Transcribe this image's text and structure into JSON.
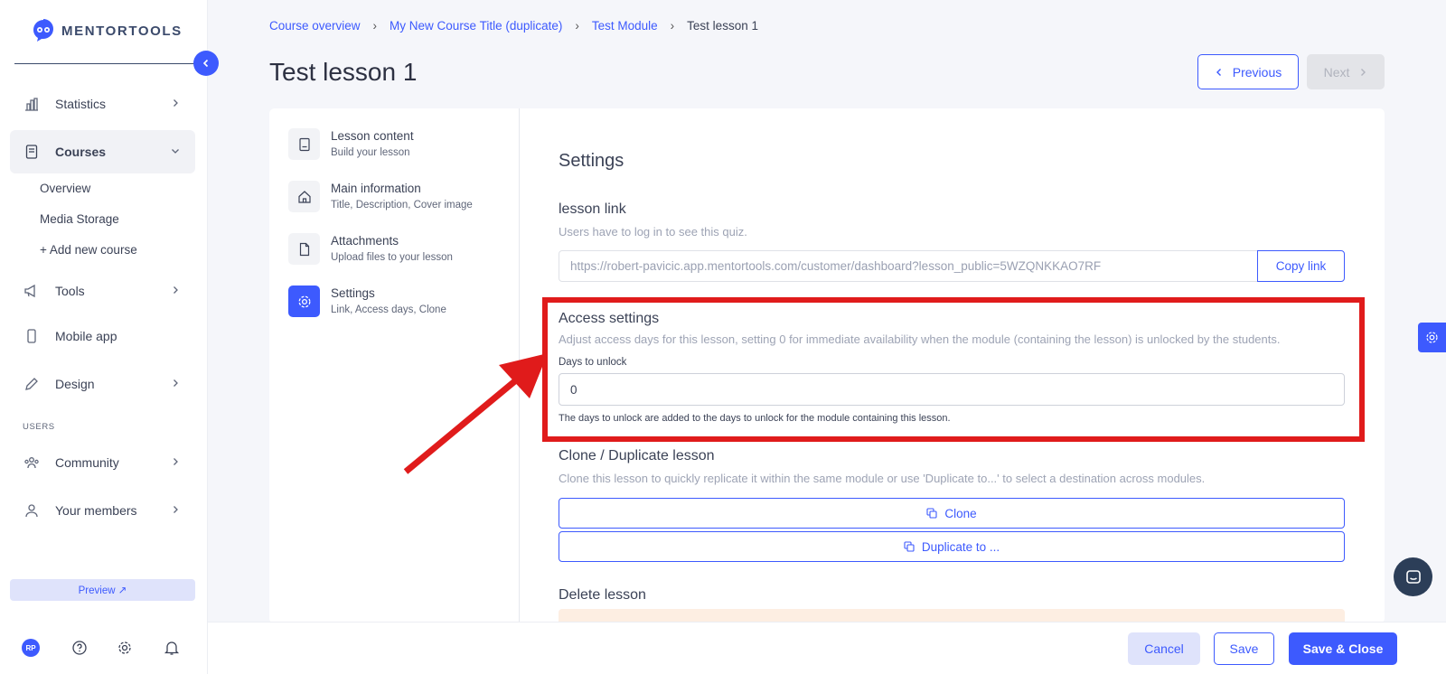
{
  "brand": {
    "name": "MENTORTOOLS"
  },
  "sidebar": {
    "items": [
      {
        "label": "Statistics",
        "icon": "bar-chart-icon"
      },
      {
        "label": "Courses",
        "icon": "book-icon"
      },
      {
        "label": "Tools",
        "icon": "megaphone-icon"
      },
      {
        "label": "Mobile app",
        "icon": "smartphone-icon"
      },
      {
        "label": "Design",
        "icon": "pencil-icon"
      },
      {
        "label": "Community",
        "icon": "people-icon"
      },
      {
        "label": "Your members",
        "icon": "user-icon"
      }
    ],
    "courses_sub": [
      "Overview",
      "Media Storage",
      "+ Add new course"
    ],
    "users_section": "USERS",
    "preview_label": "Preview ↗",
    "avatar_initials": "RP"
  },
  "breadcrumb": [
    "Course overview",
    "My New Course Title (duplicate)",
    "Test Module",
    "Test lesson 1"
  ],
  "page": {
    "title": "Test lesson 1",
    "previous_label": "Previous",
    "next_label": "Next"
  },
  "steps": [
    {
      "title": "Lesson content",
      "subtitle": "Build your lesson",
      "icon": "book-icon"
    },
    {
      "title": "Main information",
      "subtitle": "Title, Description, Cover image",
      "icon": "home-icon"
    },
    {
      "title": "Attachments",
      "subtitle": "Upload files to your lesson",
      "icon": "file-icon"
    },
    {
      "title": "Settings",
      "subtitle": "Link, Access days, Clone",
      "icon": "gear-icon"
    }
  ],
  "settings": {
    "heading": "Settings",
    "lesson_link": {
      "title": "lesson link",
      "description": "Users have to log in to see this quiz.",
      "url": "https://robert-pavicic.app.mentortools.com/customer/dashboard?lesson_public=5WZQNKKAO7RF",
      "copy_label": "Copy link"
    },
    "access": {
      "title": "Access settings",
      "description": "Adjust access days for this lesson, setting 0 for immediate availability when the module (containing the lesson) is unlocked by the students.",
      "field_label": "Days to unlock",
      "days_value": "0",
      "help": "The days to unlock are added to the days to unlock for the module containing this lesson."
    },
    "clone": {
      "title": "Clone / Duplicate lesson",
      "description": "Clone this lesson to quickly replicate it within the same module or use 'Duplicate to...' to select a destination across modules.",
      "clone_label": "Clone",
      "duplicate_label": "Duplicate to ..."
    },
    "delete": {
      "title": "Delete lesson"
    }
  },
  "footer": {
    "cancel_label": "Cancel",
    "save_label": "Save",
    "save_close_label": "Save & Close"
  },
  "colors": {
    "accent": "#3d5afe",
    "highlight": "#e01b1b",
    "chat": "#2c3e58"
  }
}
